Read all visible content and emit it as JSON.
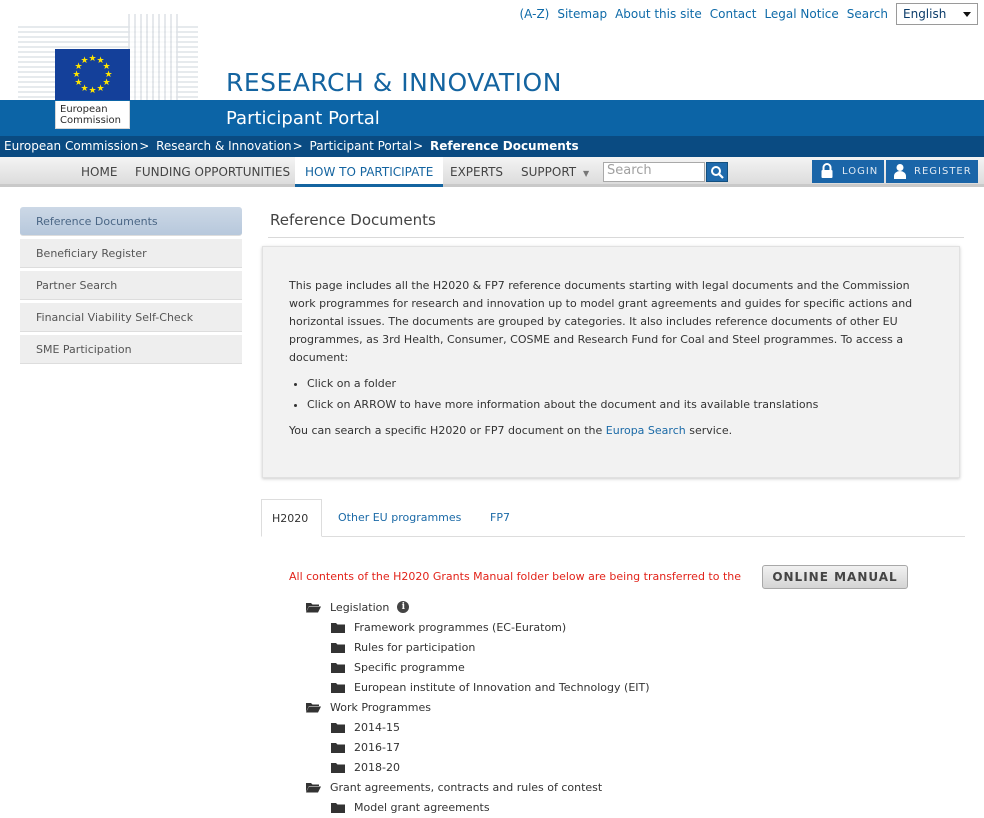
{
  "utility_links": [
    "(A-Z)",
    "Sitemap",
    "About this site",
    "Contact",
    "Legal Notice",
    "Search"
  ],
  "language": {
    "selected": "English"
  },
  "logo": {
    "line1": "European",
    "line2": "Commission"
  },
  "site_title": "RESEARCH & INNOVATION",
  "portal_title": "Participant Portal",
  "breadcrumb": {
    "items": [
      "European Commission",
      "Research & Innovation",
      "Participant Portal"
    ],
    "separator": ">",
    "current": "Reference Documents"
  },
  "nav": {
    "home": "HOME",
    "funding": "FUNDING OPPORTUNITIES",
    "how": "HOW TO PARTICIPATE",
    "experts": "EXPERTS",
    "support": "SUPPORT",
    "search_placeholder": "Search",
    "login": "LOGIN",
    "register": "REGISTER"
  },
  "sidebar": {
    "items": [
      {
        "label": "Reference Documents"
      },
      {
        "label": "Beneficiary Register"
      },
      {
        "label": "Partner Search"
      },
      {
        "label": "Financial Viability Self-Check"
      },
      {
        "label": "SME Participation"
      }
    ]
  },
  "main": {
    "heading": "Reference Documents",
    "intro": "This page includes all the H2020 & FP7 reference documents starting with legal documents and the Commission work programmes for research and innovation up to model grant agreements and guides for specific actions and horizontal issues. The documents are grouped by categories. It also includes reference documents of other EU programmes, as 3rd Health, Consumer, COSME and Research Fund for Coal and Steel programmes. To access a document:",
    "bullets": [
      "Click on a folder",
      "Click on ARROW to have more information about the document and its available translations"
    ],
    "search_prefix": "You can search a specific H2020 or FP7 document on the ",
    "search_link": "Europa Search",
    "search_suffix": " service.",
    "tabs": [
      "H2020",
      "Other EU programmes",
      "FP7"
    ],
    "notice": "All contents of the H2020 Grants Manual folder below are being transferred to the",
    "online_manual": "ONLINE MANUAL",
    "tree": [
      {
        "label": "Legislation",
        "level": 0
      },
      {
        "label": "Framework programmes (EC-Euratom)",
        "level": 1
      },
      {
        "label": "Rules for participation",
        "level": 1
      },
      {
        "label": "Specific programme",
        "level": 1
      },
      {
        "label": "European institute of Innovation and Technology (EIT)",
        "level": 1
      },
      {
        "label": "Work Programmes",
        "level": 0
      },
      {
        "label": "2014-15",
        "level": 1
      },
      {
        "label": "2016-17",
        "level": 1
      },
      {
        "label": "2018-20",
        "level": 1
      },
      {
        "label": "Grant agreements, contracts and rules of contest",
        "level": 0
      },
      {
        "label": "Model grant agreements",
        "level": 1
      }
    ]
  },
  "colors": {
    "brand_blue": "#0c64a6",
    "breadcrumb_bg": "#0a4b82",
    "notice_red": "#e2231a",
    "link_blue": "#1b6aa7"
  }
}
